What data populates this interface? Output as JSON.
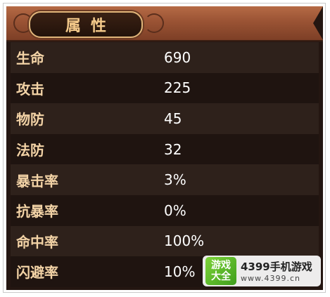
{
  "title": "属性",
  "stats": [
    {
      "name": "生命",
      "value": "690"
    },
    {
      "name": "攻击",
      "value": "225"
    },
    {
      "name": "物防",
      "value": "45"
    },
    {
      "name": "法防",
      "value": "32"
    },
    {
      "name": "暴击率",
      "value": "3%"
    },
    {
      "name": "抗暴率",
      "value": "0%"
    },
    {
      "name": "命中率",
      "value": "100%"
    },
    {
      "name": "闪避率",
      "value": "10%"
    }
  ],
  "watermark": {
    "logo_line1": "游戏",
    "logo_line2": "大全",
    "brand": "4399手机游戏",
    "url": "www.4399.cn"
  },
  "colors": {
    "banner": "#9a5334",
    "panel": "#241611",
    "label": "#f3d3a6",
    "value": "#ffffff",
    "title": "#f4c98a"
  }
}
